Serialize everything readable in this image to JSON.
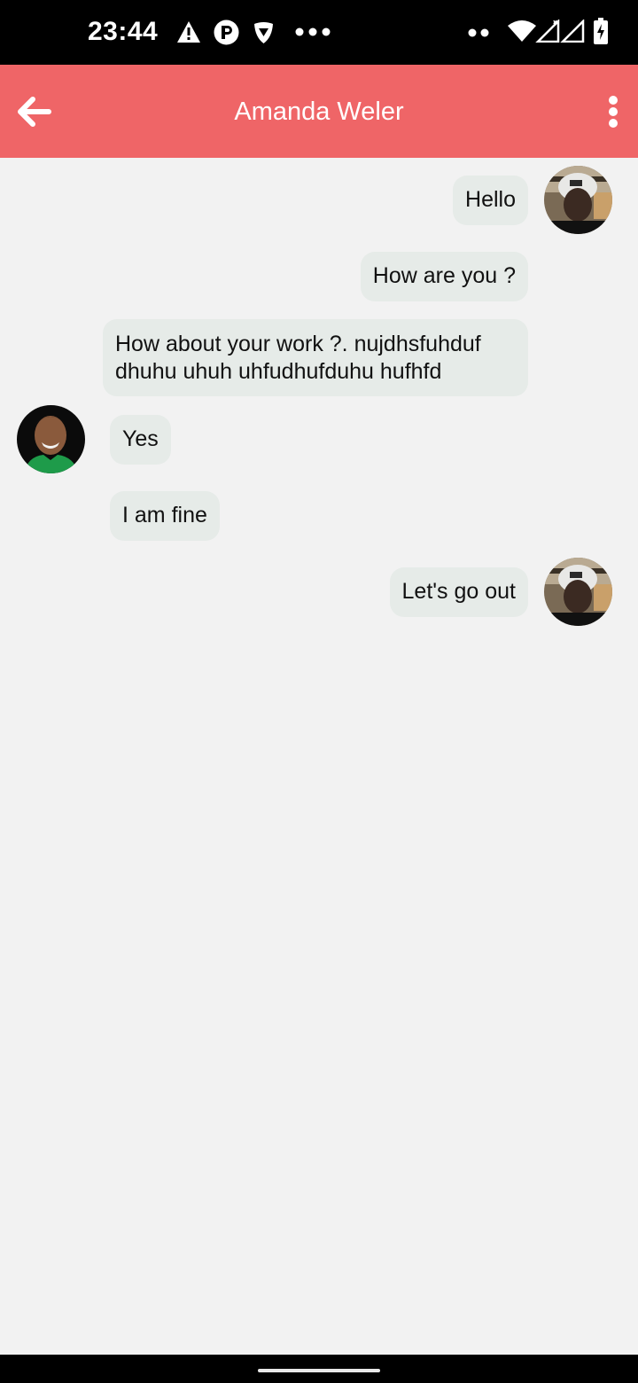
{
  "status_bar": {
    "time": "23:44",
    "left_icons": [
      "warning-icon",
      "app-p-icon",
      "vpn-shield-icon",
      "more-dots-icon"
    ],
    "right_icons": [
      "dots-icon",
      "wifi-icon",
      "signal-icon",
      "signal-no-data-icon",
      "battery-charging-icon"
    ]
  },
  "app_bar": {
    "title": "Amanda Weler",
    "background_color": "#ef6567",
    "back_icon": "arrow-left-icon",
    "menu_icon": "more-vertical-icon"
  },
  "messages": [
    {
      "side": "right",
      "text": "Hello",
      "show_avatar": true
    },
    {
      "side": "right",
      "text": "How are you ?",
      "show_avatar": false
    },
    {
      "side": "right",
      "text": "How about your work ?. nujdhsfuhduf dhuhu uhuh uhfudhufduhu hufhfd",
      "show_avatar": false
    },
    {
      "side": "left",
      "text": "Yes",
      "show_avatar": true
    },
    {
      "side": "left",
      "text": "I am fine",
      "show_avatar": false
    },
    {
      "side": "right",
      "text": "Let's go out",
      "show_avatar": true
    }
  ],
  "colors": {
    "bubble": "#e6ebe8",
    "background": "#f2f2f2"
  }
}
